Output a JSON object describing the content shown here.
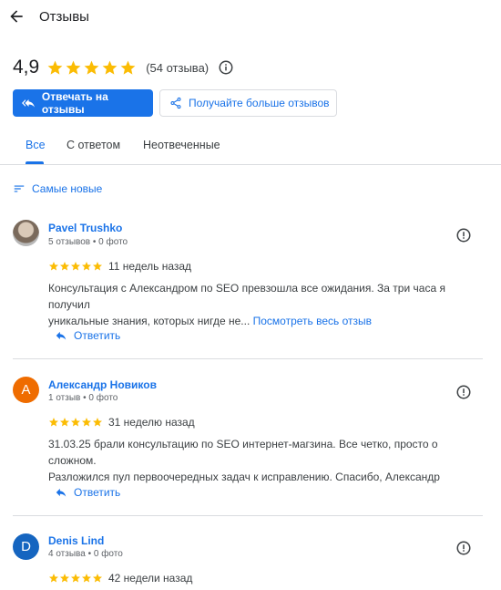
{
  "header": {
    "title": "Отзывы",
    "back_icon": "arrow-left-icon"
  },
  "summary": {
    "rating": "4,9",
    "stars": 5,
    "count_text": "(54 отзыва)",
    "info_icon": "info-icon"
  },
  "actions": {
    "reply_label": "Отвечать на отзывы",
    "get_more_label": "Получайте больше отзывов"
  },
  "tabs": [
    {
      "label": "Все",
      "active": true
    },
    {
      "label": "С ответом",
      "active": false
    },
    {
      "label": "Неотвеченные",
      "active": false
    }
  ],
  "sort": {
    "label": "Самые новые",
    "icon": "sort-icon"
  },
  "colors": {
    "accent": "#1a73e8",
    "star": "#fbbc04",
    "orange_avatar": "#ef6c00",
    "blue_avatar": "#1565c0"
  },
  "reviews": [
    {
      "name": "Pavel Trushko",
      "meta": "5 отзывов • 0 фото",
      "avatar": "photo",
      "stars": 5,
      "when": "11 недель назад",
      "text_line1": "Консультация с Александром по SEO превзошла все ожидания. За три часа я получил",
      "text_line2": "уникальные знания, которых нигде не...",
      "more": "Посмотреть весь отзыв",
      "reply": "Ответить"
    },
    {
      "name": "Александр Новиков",
      "meta": "1 отзыв • 0 фото",
      "avatar_letter": "А",
      "stars": 5,
      "when": "31 неделю назад",
      "text_line1": "31.03.25 брали консультацию по SEO интернет-магзина. Все четко, просто о сложном.",
      "text_line2": "Разложился пул первоочередных задач к исправлению. Спасибо, Александр",
      "reply": "Ответить"
    },
    {
      "name": "Denis Lind",
      "meta": "4 отзыва • 0 фото",
      "avatar_letter": "D",
      "stars": 5,
      "when": "42 недели назад"
    }
  ]
}
